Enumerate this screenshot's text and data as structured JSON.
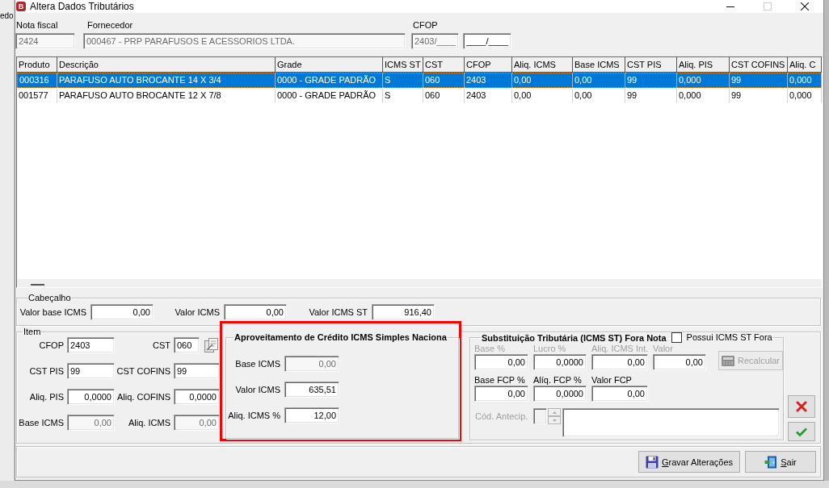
{
  "background_app": {
    "text_fragment": "edo"
  },
  "window": {
    "title": "Altera Dados Tributários",
    "app_icon_letter": "B",
    "maximize_disabled": true
  },
  "header_fields": [
    {
      "label": "Nota fiscal",
      "inputs": [
        {
          "value": "2424",
          "disabled": true
        }
      ]
    },
    {
      "label": "Fornecedor",
      "inputs": [
        {
          "value": "000467 - PRP PARAFUSOS E ACESSORIOS LTDA.",
          "disabled": true
        }
      ]
    },
    {
      "label": "CFOP",
      "inputs": [
        {
          "value": "2403/____",
          "disabled": true
        },
        {
          "value": "____/____",
          "disabled": false
        }
      ]
    }
  ],
  "table": {
    "columns": [
      "Produto",
      "Descrição",
      "Grade",
      "ICMS ST",
      "CST",
      "CFOP",
      "Aliq. ICMS",
      "Base ICMS",
      "CST PIS",
      "Aliq. PIS",
      "CST COFINS",
      "Aliq. C"
    ],
    "rows": [
      {
        "selected": true,
        "cells": [
          "000316",
          "PARAFUSO AUTO BROCANTE 14 X 3/4",
          "0000 - GRADE PADRÃO",
          "S",
          "060",
          "2403",
          "0,00",
          "0,00",
          "99",
          "0,000",
          "99",
          "0,000"
        ]
      },
      {
        "selected": false,
        "cells": [
          "001577",
          "PARAFUSO AUTO BROCANTE 12 X 7/8",
          "0000 - GRADE PADRÃO",
          "S",
          "060",
          "2403",
          "0,00",
          "0,00",
          "99",
          "0,000",
          "99",
          "0,000"
        ]
      }
    ]
  },
  "cabecalho": {
    "title": "Cabeçalho",
    "fields": [
      {
        "label": "Valor base ICMS",
        "value": "0,00"
      },
      {
        "label": "Valor ICMS",
        "value": "0,00"
      },
      {
        "label": "Valor ICMS ST",
        "value": "916,40"
      }
    ]
  },
  "item": {
    "title": "Item",
    "fields": [
      {
        "label": "CFOP",
        "value": "2403",
        "kind": "text",
        "disabled": false
      },
      {
        "label": "CST",
        "value": "060",
        "kind": "lookup",
        "disabled": false
      },
      {
        "label": "CST PIS",
        "value": "99",
        "kind": "text",
        "disabled": false
      },
      {
        "label": "CST COFINS",
        "value": "99",
        "kind": "text",
        "disabled": false
      },
      {
        "label": "Aliq. PIS",
        "value": "0,0000",
        "kind": "number",
        "disabled": false
      },
      {
        "label": "Aliq. COFINS",
        "value": "0,0000",
        "kind": "number",
        "disabled": false
      },
      {
        "label": "Base ICMS",
        "value": "0,00",
        "kind": "number",
        "disabled": true
      },
      {
        "label": "Aliq. ICMS",
        "value": "0,00",
        "kind": "number",
        "disabled": true
      }
    ]
  },
  "credit_panel": {
    "title": "Aproveitamento de Crédito ICMS Simples Naciona",
    "highlighted": true,
    "fields": [
      {
        "label": "Base ICMS",
        "value": "0,00",
        "disabled": true
      },
      {
        "label": "Valor ICMS",
        "value": "635,51",
        "disabled": false
      },
      {
        "label": "Aliq. ICMS %",
        "value": "12,00",
        "disabled": false
      }
    ]
  },
  "st_panel": {
    "title": "Substituição Tributária (ICMS ST) Fora Nota",
    "checkbox": {
      "label": "Possui ICMS ST Fora",
      "checked": false
    },
    "fields": [
      {
        "label": "Base %",
        "value": "0,00",
        "disabled": true
      },
      {
        "label": "Lucro %",
        "value": "0,0000",
        "disabled": true
      },
      {
        "label": "Aliq. ICMS Int.",
        "value": "0,00",
        "disabled": true
      },
      {
        "label": "Valor",
        "value": "0,00",
        "disabled": true
      },
      {
        "label": "Base FCP %",
        "value": "0,00",
        "disabled": false
      },
      {
        "label": "Alíq. FCP %",
        "value": "0,0000",
        "disabled": false
      },
      {
        "label": "Valor FCP",
        "value": "0,00",
        "disabled": false
      }
    ],
    "recalc_button": {
      "label": "Recalcular",
      "disabled": true
    },
    "antecip": {
      "label": "Cód. Antecip.",
      "disabled": true
    }
  },
  "footer_buttons": [
    {
      "label": "Gravar Alterações",
      "kind": "save"
    },
    {
      "label": "Sair",
      "kind": "exit"
    }
  ]
}
